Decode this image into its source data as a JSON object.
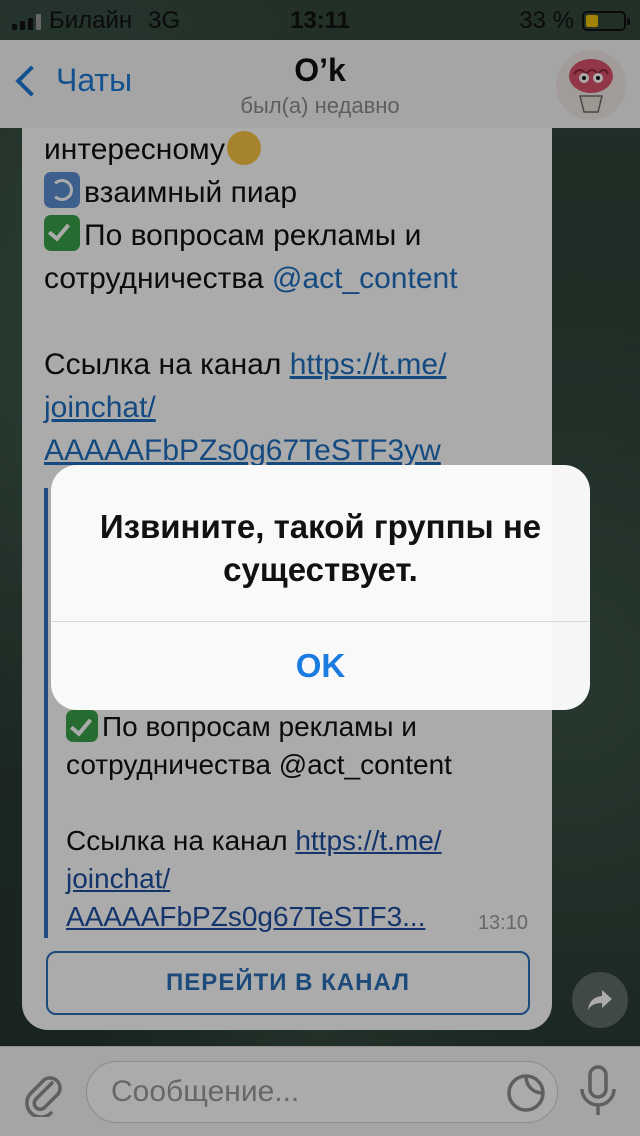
{
  "status_bar": {
    "carrier": "Билайн",
    "network": "3G",
    "time": "13:11",
    "battery_text": "33 %",
    "battery_level": 0.33
  },
  "nav": {
    "back_label": "Чаты",
    "title": "O’k",
    "subtitle": "был(а) недавно"
  },
  "message": {
    "line1": "интересному",
    "line2": "взаимный пиар",
    "line3a": "По вопросам рекламы и",
    "line3b": "сотрудничества ",
    "contact": "@act_content",
    "link_prefix": "Ссылка на канал ",
    "link_part1": "https://t.me/",
    "link_part2": "joinchat/",
    "link_part3": "AAAAAFbPZs0g67TeSTF3yw",
    "quote_line1a": "По вопросам рекламы и",
    "quote_line1b": "сотрудничества @act_content",
    "quote_link_prefix": "Ссылка на канал ",
    "quote_link1": "https://t.me/",
    "quote_link2": "joinchat/",
    "quote_link3": "AAAAAFbPZs0g67TeSTF3...",
    "time": "13:10",
    "channel_button": "ПЕРЕЙТИ В КАНАЛ"
  },
  "input": {
    "placeholder": "Сообщение..."
  },
  "alert": {
    "title": "Извините, такой группы не существует.",
    "ok": "OK"
  },
  "icons": {
    "back": "chevron-left-icon",
    "attach": "paperclip-icon",
    "sticker": "sticker-icon",
    "mic": "microphone-icon",
    "share": "share-arrow-icon"
  },
  "colors": {
    "accent": "#1f7ad6",
    "link": "#1f6fbf",
    "check_emoji": "#3aa14a",
    "battery_fill": "#f0c400"
  }
}
